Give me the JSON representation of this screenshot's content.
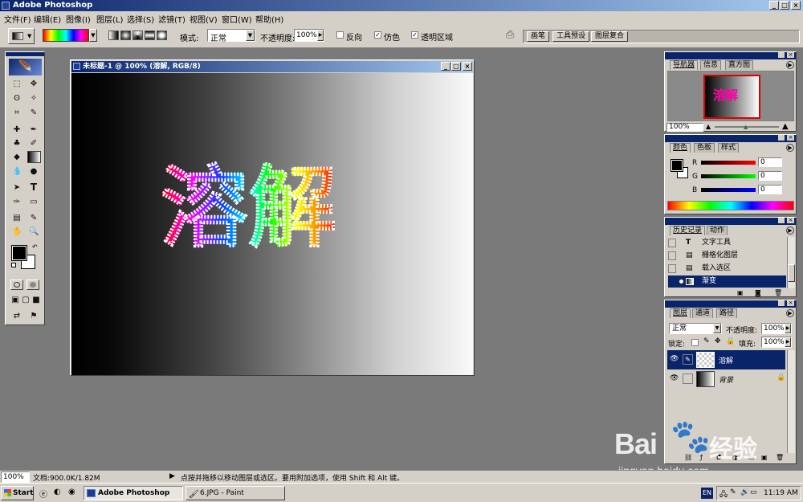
{
  "app": {
    "title": "Adobe Photoshop"
  },
  "menu": [
    "文件(F)",
    "编辑(E)",
    "图像(I)",
    "图层(L)",
    "选择(S)",
    "滤镜(T)",
    "视图(V)",
    "窗口(W)",
    "帮助(H)"
  ],
  "options": {
    "mode_label": "模式:",
    "mode_value": "正常",
    "opacity_label": "不透明度:",
    "opacity_value": "100%",
    "reverse_label": "反向",
    "dither_label": "仿色",
    "transparency_label": "透明区域",
    "palette_tabs": [
      "画笔",
      "工具预设",
      "图层复合"
    ]
  },
  "document": {
    "title": "未标题-1 @ 100% (溶解, RGB/8)",
    "text": "溶解"
  },
  "navigator": {
    "tabs": [
      "导航器",
      "信息",
      "直方图"
    ],
    "zoom": "100%"
  },
  "color": {
    "tabs": [
      "颜色",
      "色板",
      "样式"
    ],
    "r_label": "R",
    "g_label": "G",
    "b_label": "B",
    "r_value": "0",
    "g_value": "0",
    "b_value": "0"
  },
  "history": {
    "tabs": [
      "历史记录",
      "动作"
    ],
    "items": [
      "文字工具",
      "栅格化图层",
      "载入选区",
      "渐变"
    ]
  },
  "layers": {
    "tabs": [
      "图层",
      "通道",
      "路径"
    ],
    "blend_mode": "正常",
    "opacity_label": "不透明度:",
    "opacity_value": "100%",
    "lock_label": "锁定:",
    "fill_label": "填充:",
    "fill_value": "100%",
    "items": [
      "溶解",
      "背景"
    ]
  },
  "status": {
    "zoom": "100%",
    "doc_info": "文档:900.0K/1.82M",
    "hint": "点按并拖移以移动图层或选区。要用附加选项，使用 Shift 和 Alt 键。"
  },
  "taskbar": {
    "start": "Start",
    "tasks": [
      "Adobe Photoshop",
      "6.JPG - Paint"
    ],
    "lang": "EN",
    "clock": "11:19 AM"
  },
  "watermark": {
    "brand": "Bai",
    "brand2": "经验",
    "url": "jingyan.baidu.com"
  }
}
